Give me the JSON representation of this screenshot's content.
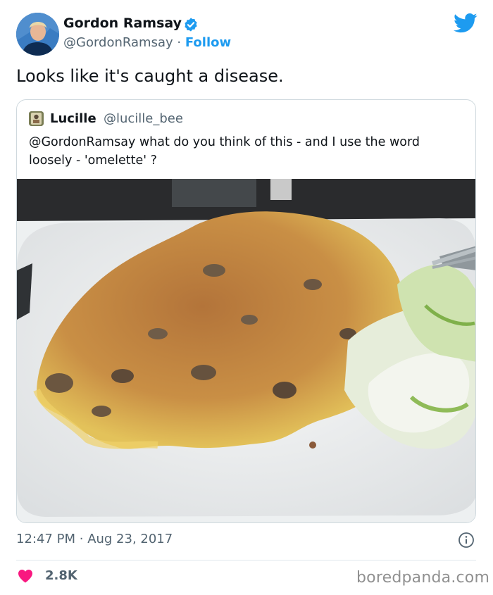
{
  "tweet": {
    "author": {
      "name": "Gordon Ramsay",
      "handle": "@GordonRamsay",
      "separator": "·",
      "follow_label": "Follow",
      "verified": true
    },
    "text": "Looks like it's caught a disease.",
    "quoted": {
      "author_name": "Lucille",
      "author_handle": "@lucille_bee",
      "text": "@GordonRamsay what do you think of this - and I use the word loosely - 'omelette' ?"
    },
    "time": "12:47 PM",
    "date_separator": "·",
    "date": "Aug 23, 2017",
    "likes": "2.8K"
  },
  "watermark": "boredpanda.com",
  "colors": {
    "twitter_blue": "#1d9bf0",
    "like_red": "#f91880",
    "secondary_text": "#536471",
    "border": "#cfd9de"
  },
  "icons": {
    "verified": "verified-badge-icon",
    "brand": "twitter-bird-icon",
    "info": "info-icon",
    "like": "heart-icon"
  }
}
